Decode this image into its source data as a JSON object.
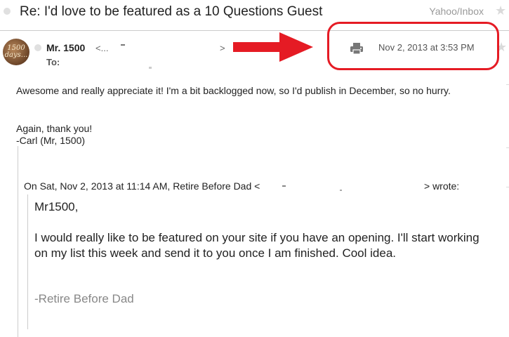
{
  "header": {
    "subject": "Re: I'd love to be featured as a 10 Questions Guest",
    "folder": "Yahoo/Inbox"
  },
  "message": {
    "avatar_text": "1500 days...",
    "sender_name": "Mr. 1500",
    "sender_email_open": "<...",
    "sender_email_close": ">",
    "to_label": "To:",
    "timestamp": "Nov 2, 2013 at 3:53 PM",
    "body_paragraph_1": "Awesome and really appreciate it! I'm a bit backlogged now, so I'd publish in December, so no hurry.",
    "body_paragraph_2_line_1": "Again, thank you!",
    "body_paragraph_2_line_2": "-Carl (Mr, 1500)"
  },
  "quote": {
    "intro": "On Sat, Nov 2, 2013 at 11:14 AM, Retire Before Dad <",
    "wrote_tail": "> wrote:",
    "greeting": "Mr1500,",
    "body": "I would really like to be featured on your site if you have an opening. I'll start working on my list this week and send it to you once I am finished. Cool idea.",
    "signature": "-Retire Before Dad"
  },
  "icons": {
    "print": "printer-icon",
    "star": "star-icon",
    "annotation_arrow": "red-arrow-right"
  },
  "colors": {
    "annotation_red": "#e51b24",
    "muted_text": "#888888",
    "icon_gray": "#777777"
  }
}
